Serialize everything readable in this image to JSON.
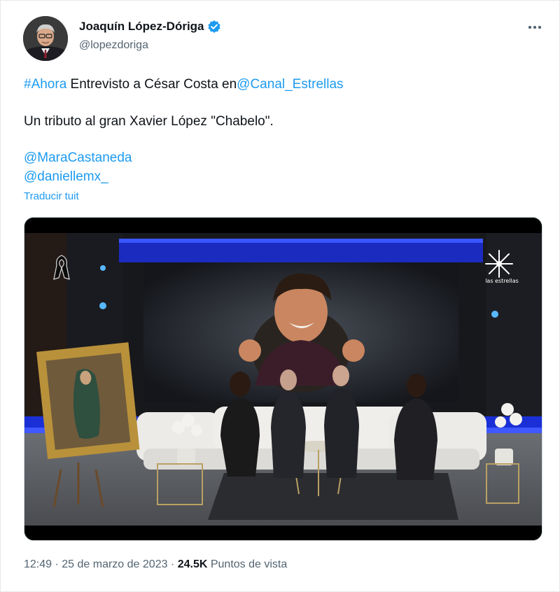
{
  "author": {
    "name": "Joaquín López-Dóriga",
    "handle": "@lopezdoriga",
    "verified": true
  },
  "tweet": {
    "line1": {
      "hashtag": "#Ahora",
      "text": " Entrevisto a César Costa en",
      "mention": "@Canal_Estrellas"
    },
    "line2": "Un tributo al gran Xavier López \"Chabelo\".",
    "mentions": [
      "@MaraCastaneda",
      "@daniellemx_"
    ],
    "translate_label": "Traducir tuit"
  },
  "media": {
    "channel_logo_text": "las estrellas"
  },
  "meta": {
    "time": "12:49",
    "separator": " · ",
    "date": "25 de marzo de 2023",
    "views_count": "24.5K",
    "views_label": " Puntos de vista"
  },
  "colors": {
    "link": "#1d9bf0",
    "secondary_text": "#536471",
    "primary_text": "#0f1419"
  },
  "icons": [
    "verified-badge-icon",
    "more-options-icon",
    "mourning-ribbon-icon",
    "channel-star-logo-icon"
  ]
}
